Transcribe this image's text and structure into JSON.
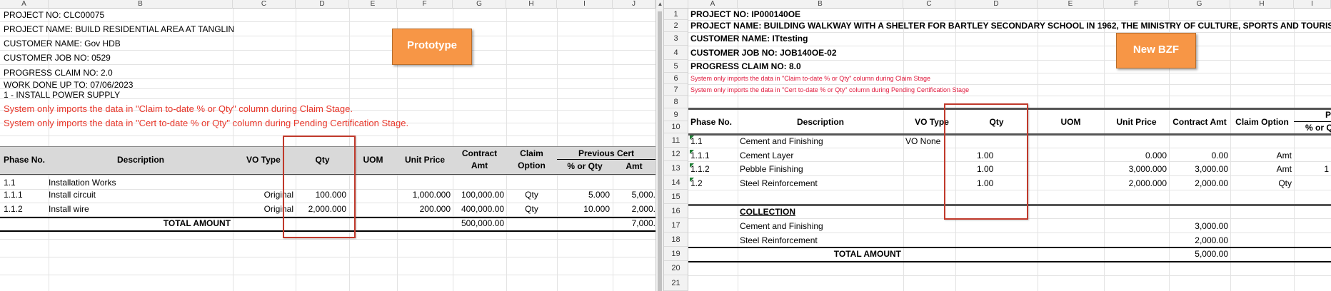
{
  "left": {
    "columns": [
      "A",
      "B",
      "C",
      "D",
      "E",
      "F",
      "G",
      "H",
      "I",
      "J"
    ],
    "header_lines": {
      "project_no": "PROJECT NO: CLC00075",
      "project_name": "PROJECT NAME: BUILD RESIDENTIAL AREA AT TANGLIN",
      "customer_name": "CUSTOMER NAME: Gov HDB",
      "customer_job_no": "CUSTOMER JOB NO: 0529",
      "progress_claim_no": "PROGRESS CLAIM NO: 2.0",
      "work_done_up_to": "WORK DONE UP TO: 07/06/2023",
      "section": "1 - INSTALL POWER SUPPLY",
      "note1": "System only imports the data in \"Claim to-date % or Qty\" column during Claim Stage.",
      "note2": "System only imports the data in \"Cert to-date % or Qty\" column during Pending Certification Stage."
    },
    "callout": "Prototype",
    "table_headers": {
      "phase_no": "Phase No.",
      "description": "Description",
      "vo_type": "VO Type",
      "qty": "Qty",
      "uom": "UOM",
      "unit_price": "Unit Price",
      "contract_amt_1": "Contract",
      "contract_amt_2": "Amt",
      "claim_option_1": "Claim",
      "claim_option_2": "Option",
      "previous_cert": "Previous Cert",
      "pct_or_qty": "% or Qty",
      "amt": "Amt"
    },
    "rows": [
      {
        "phase": "1.1",
        "desc": "Installation Works",
        "vo": "",
        "qty": "",
        "unit_price": "",
        "contract_amt": "",
        "claim_option": "",
        "prev_pct": "",
        "prev_amt": ""
      },
      {
        "phase": "1.1.1",
        "desc": "Install circuit",
        "vo": "Original",
        "qty": "100.000",
        "unit_price": "1,000.000",
        "contract_amt": "100,000.00",
        "claim_option": "Qty",
        "prev_pct": "5.000",
        "prev_amt": "5,000."
      },
      {
        "phase": "1.1.2",
        "desc": "Install wire",
        "vo": "Original",
        "qty": "2,000.000",
        "unit_price": "200.000",
        "contract_amt": "400,000.00",
        "claim_option": "Qty",
        "prev_pct": "10.000",
        "prev_amt": "2,000."
      }
    ],
    "total_label": "TOTAL AMOUNT",
    "total_contract_amt": "500,000.00",
    "total_prev_amt": "7,000."
  },
  "right": {
    "columns": [
      "A",
      "B",
      "C",
      "D",
      "E",
      "F",
      "G",
      "H",
      "I"
    ],
    "row_numbers": [
      "1",
      "2",
      "3",
      "4",
      "5",
      "6",
      "7",
      "8",
      "9",
      "10",
      "11",
      "12",
      "13",
      "14",
      "15",
      "16",
      "17",
      "18",
      "19",
      "20",
      "21"
    ],
    "header_lines": {
      "project_no": "PROJECT NO: IP000140OE",
      "project_name": "PROJECT NAME: BUILDING WALKWAY WITH A SHELTER FOR BARTLEY SECONDARY SCHOOL IN 1962, THE MINISTRY OF CULTURE, SPORTS AND TOURISM OF NOR",
      "customer_name": "CUSTOMER NAME: ITtesting",
      "customer_job_no": "CUSTOMER JOB NO: JOB140OE-02",
      "progress_claim_no": "PROGRESS CLAIM NO: 8.0",
      "note1": "System only imports the data in \"Claim to-date % or Qty\" column during Claim Stage",
      "note2": "System only imports the data in \"Cert to-date % or Qty\" column during Pending Certification Stage"
    },
    "callout": "New BZF",
    "table_headers": {
      "phase_no": "Phase No.",
      "description": "Description",
      "vo_type": "VO Type",
      "qty": "Qty",
      "uom": "UOM",
      "unit_price": "Unit Price",
      "contract_amt": "Contract Amt",
      "claim_option": "Claim Option",
      "prev_top": "P",
      "prev_sub": "% or Q"
    },
    "rows": [
      {
        "phase": "1.1",
        "desc": "Cement and Finishing",
        "vo": "VO None",
        "qty": "",
        "unit_price": "",
        "contract_amt": "",
        "claim_option": "",
        "extra": ""
      },
      {
        "phase": "1.1.1",
        "desc": "Cement Layer",
        "vo": "",
        "qty": "1.00",
        "unit_price": "0.000",
        "contract_amt": "0.00",
        "claim_option": "Amt",
        "extra": ""
      },
      {
        "phase": "1.1.2",
        "desc": "Pebble Finishing",
        "vo": "",
        "qty": "1.00",
        "unit_price": "3,000.000",
        "contract_amt": "3,000.00",
        "claim_option": "Amt",
        "extra": "1"
      },
      {
        "phase": "1.2",
        "desc": "Steel Reinforcement",
        "vo": "",
        "qty": "1.00",
        "unit_price": "2,000.000",
        "contract_amt": "2,000.00",
        "claim_option": "Qty",
        "extra": ""
      }
    ],
    "collection_label": "COLLECTION",
    "collection": [
      {
        "desc": "Cement and Finishing",
        "amt": "3,000.00"
      },
      {
        "desc": "Steel Reinforcement",
        "amt": "2,000.00"
      }
    ],
    "total_label": "TOTAL AMOUNT",
    "total_amt": "5,000.00"
  },
  "colors": {
    "callout": "#f79646",
    "red_note": "#e8362a",
    "header_band": "#d9d9d9",
    "highlight_box": "#c0392b"
  }
}
